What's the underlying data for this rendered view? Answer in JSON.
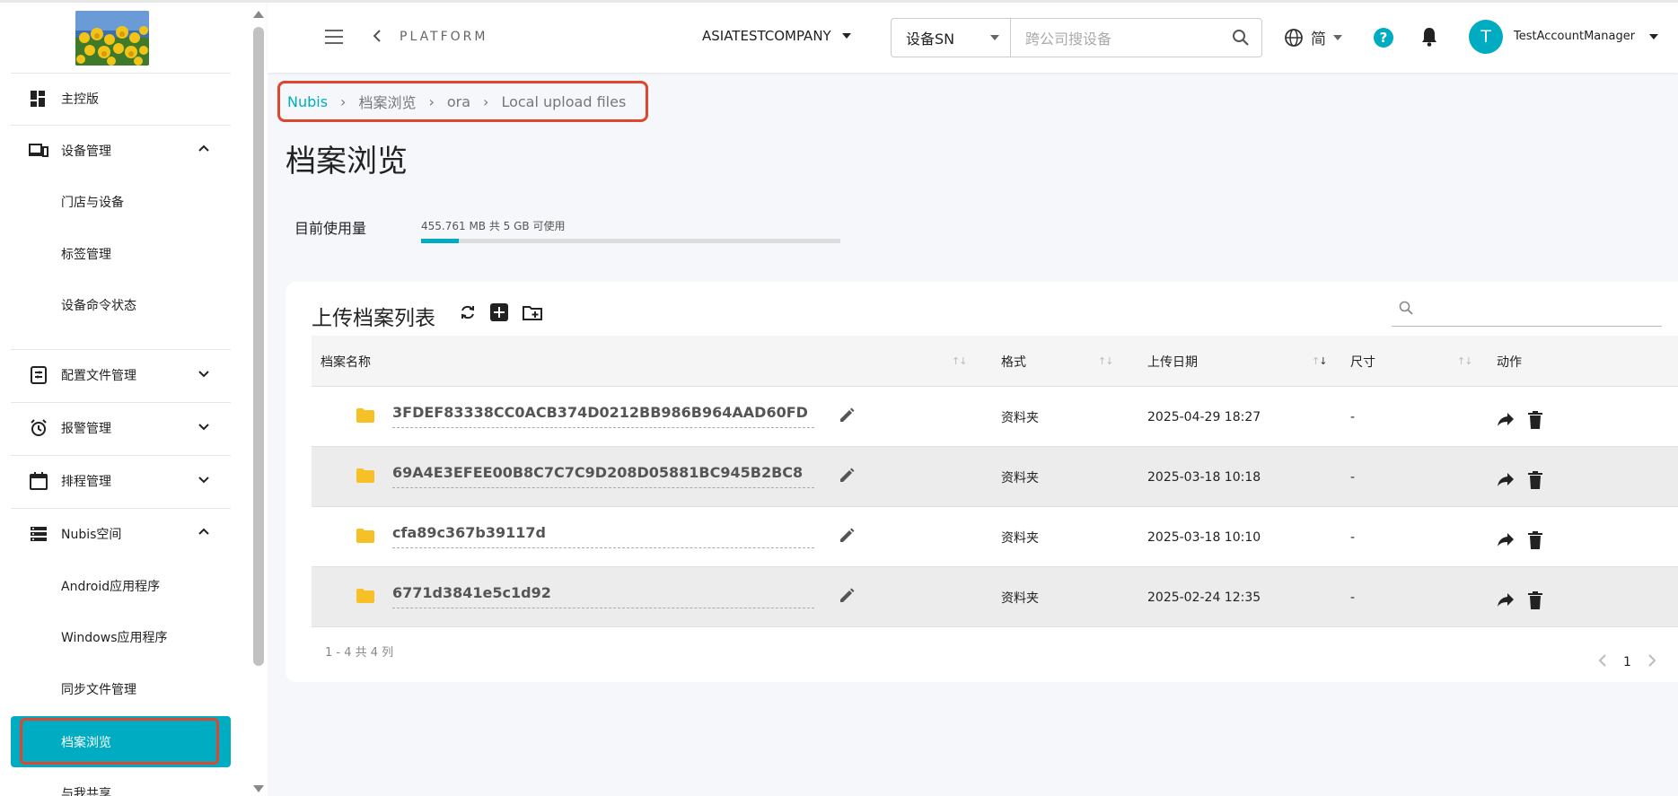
{
  "header": {
    "platform": "PLATFORM",
    "company": "ASIATESTCOMPANY",
    "search_select": "设备SN",
    "search_placeholder": "跨公司搜设备",
    "language": "简",
    "help": "?",
    "avatar_initial": "T",
    "username": "TestAccountManager"
  },
  "sidebar": {
    "items": [
      {
        "label": "主控版",
        "icon": "dashboard-icon"
      },
      {
        "label": "设备管理",
        "icon": "devices-icon"
      },
      {
        "label": "门店与设备"
      },
      {
        "label": "标签管理"
      },
      {
        "label": "设备命令状态"
      },
      {
        "label": "配置文件管理",
        "icon": "config-file-icon"
      },
      {
        "label": "报警管理",
        "icon": "alarm-icon"
      },
      {
        "label": "排程管理",
        "icon": "calendar-icon"
      },
      {
        "label": "Nubis空间",
        "icon": "storage-icon"
      },
      {
        "label": "Android应用程序"
      },
      {
        "label": "Windows应用程序"
      },
      {
        "label": "同步文件管理"
      },
      {
        "label": "档案浏览"
      },
      {
        "label": "与我共享"
      }
    ]
  },
  "breadcrumb": [
    "Nubis",
    "档案浏览",
    "ora",
    "Local upload files"
  ],
  "page_title": "档案浏览",
  "usage": {
    "label": "目前使用量",
    "text": "455.761 MB 共 5 GB 可使用",
    "fraction": 0.089
  },
  "card": {
    "title": "上传档案列表",
    "columns": [
      "档案名称",
      "格式",
      "上传日期",
      "尺寸",
      "动作"
    ],
    "rows": [
      {
        "name": "3FDEF83338CC0ACB374D0212BB986B964AAD60FD",
        "format": "资料夹",
        "date": "2025-04-29 18:27",
        "size": "-"
      },
      {
        "name": "69A4E3EFEE00B8C7C7C9D208D05881BC945B2BC8",
        "format": "资料夹",
        "date": "2025-03-18 10:18",
        "size": "-"
      },
      {
        "name": "cfa89c367b39117d",
        "format": "资料夹",
        "date": "2025-03-18 10:10",
        "size": "-"
      },
      {
        "name": "6771d3841e5c1d92",
        "format": "资料夹",
        "date": "2025-02-24 12:35",
        "size": "-"
      }
    ],
    "pager_info": "1 - 4 共 4 列",
    "page": "1"
  },
  "colors": {
    "accent": "#00acc1",
    "highlight": "#e0452f",
    "folder": "#f6c026"
  }
}
